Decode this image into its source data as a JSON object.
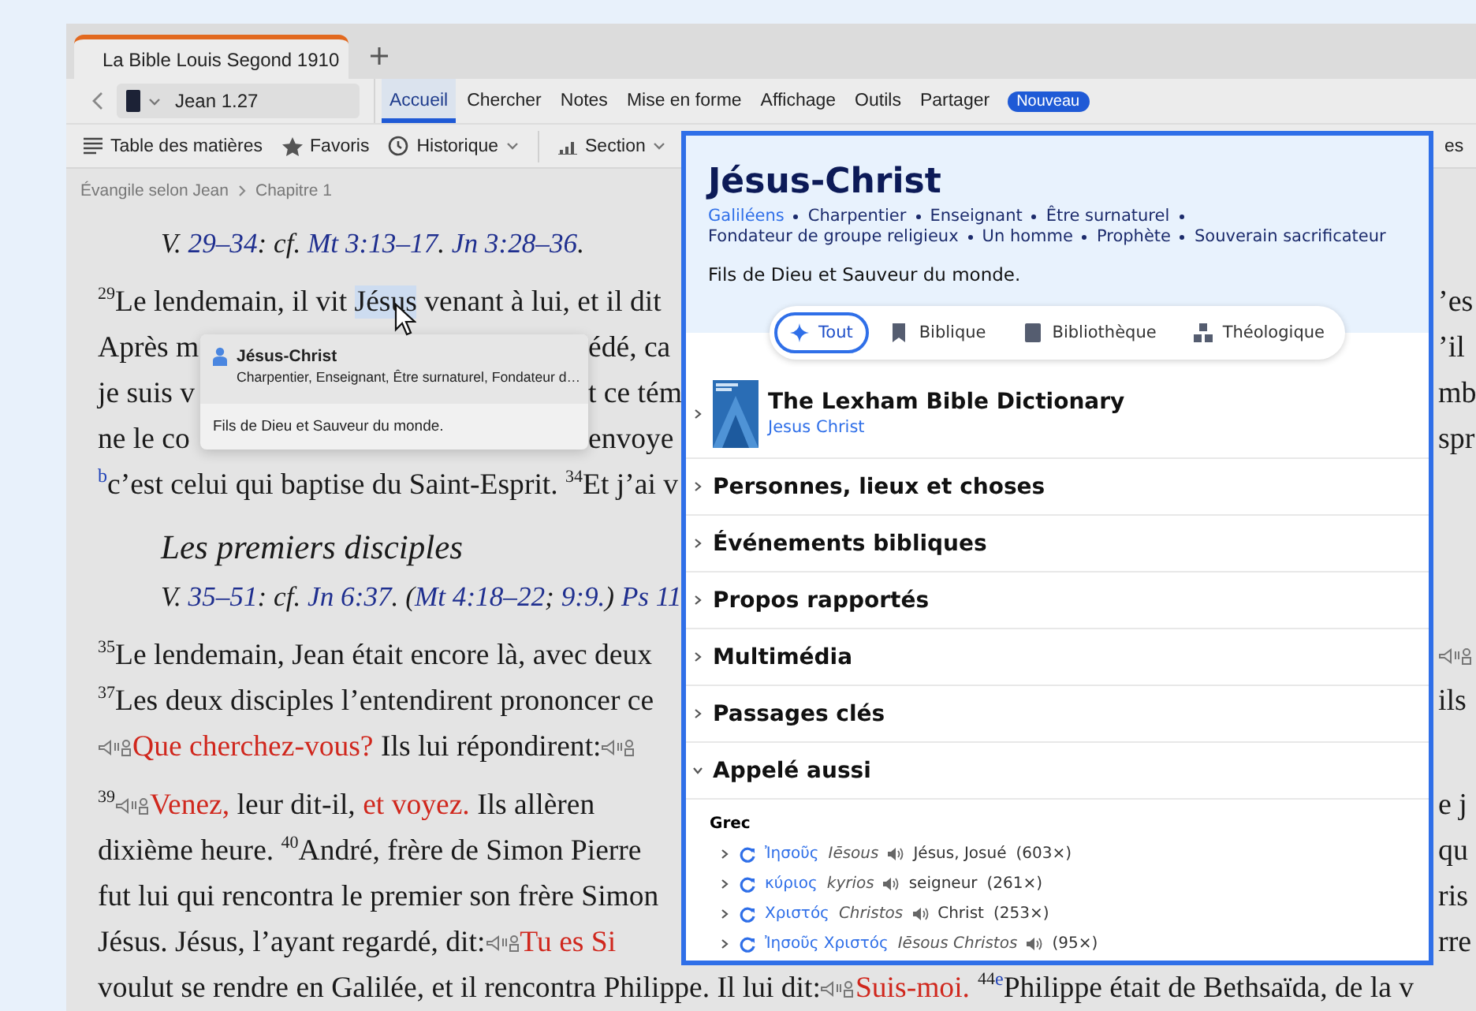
{
  "tabs": [
    {
      "title": "La Bible Louis Segond 1910",
      "selected": true
    }
  ],
  "nav": {
    "reference": "Jean 1.27"
  },
  "menu": [
    {
      "label": "Accueil",
      "selected": true
    },
    {
      "label": "Chercher",
      "selected": false
    },
    {
      "label": "Notes",
      "selected": false
    },
    {
      "label": "Mise en forme",
      "selected": false
    },
    {
      "label": "Affichage",
      "selected": false
    },
    {
      "label": "Outils",
      "selected": false
    },
    {
      "label": "Partager",
      "selected": false
    }
  ],
  "menu_badge": "Nouveau",
  "toolbar": [
    {
      "label": "Table des matières",
      "kind": "toc",
      "dropdown": false
    },
    {
      "label": "Favoris",
      "kind": "star",
      "dropdown": false
    },
    {
      "label": "Historique",
      "kind": "history",
      "dropdown": true
    },
    {
      "label": "Section",
      "kind": "section",
      "dropdown": true
    }
  ],
  "toolbar_fragment": "es",
  "breadcrumb": [
    "Évangile selon Jean",
    "Chapitre 1"
  ],
  "reader": {
    "paragraphs": [
      {
        "kind": "ref",
        "lines": [
          {
            "segments": [
              {
                "kind": "text",
                "text": "V. "
              },
              {
                "kind": "ref",
                "text": "29–34"
              },
              {
                "kind": "text",
                "text": ": cf. "
              },
              {
                "kind": "ref",
                "text": "Mt 3:13–17"
              },
              {
                "kind": "text",
                "text": ". "
              },
              {
                "kind": "ref",
                "text": "Jn 3:28–36"
              },
              {
                "kind": "text",
                "text": "."
              }
            ]
          }
        ]
      },
      {
        "kind": "text",
        "lines": [
          {
            "segments": [
              {
                "kind": "verse",
                "text": "29"
              },
              {
                "kind": "text",
                "text": "Le lendemain, il vit "
              },
              {
                "kind": "highlight",
                "text": "Jésus"
              },
              {
                "kind": "text",
                "text": " venant à lui, et il dit"
              }
            ],
            "edge": "’es"
          },
          {
            "segments": [
              {
                "kind": "text",
                "text": "Après m"
              }
            ],
            "resume": [
              {
                "kind": "text",
                "text": "édé, ca"
              }
            ],
            "edge": "’il"
          },
          {
            "segments": [
              {
                "kind": "text",
                "text": "je suis v"
              }
            ],
            "resume": [
              {
                "kind": "text",
                "text": "t ce tém"
              }
            ],
            "edge": "mb"
          },
          {
            "segments": [
              {
                "kind": "text",
                "text": "ne le co"
              }
            ],
            "resume": [
              {
                "kind": "text",
                "text": "envoye"
              }
            ],
            "edge": "spr"
          },
          {
            "segments": [
              {
                "kind": "note",
                "text": "b"
              },
              {
                "kind": "text",
                "text": "c’est celui qui baptise du Saint-Esprit. "
              },
              {
                "kind": "verse",
                "text": "34"
              },
              {
                "kind": "text",
                "text": "Et j’ai v"
              }
            ]
          }
        ]
      },
      {
        "kind": "heading",
        "lines": [
          {
            "segments": [
              {
                "kind": "text",
                "text": "Les premiers disciples"
              }
            ]
          }
        ]
      },
      {
        "kind": "ref",
        "lines": [
          {
            "segments": [
              {
                "kind": "text",
                "text": "V. "
              },
              {
                "kind": "ref",
                "text": "35–51"
              },
              {
                "kind": "text",
                "text": ": cf. "
              },
              {
                "kind": "ref",
                "text": "Jn 6:37"
              },
              {
                "kind": "text",
                "text": ". ("
              },
              {
                "kind": "ref",
                "text": "Mt 4:18–22"
              },
              {
                "kind": "text",
                "text": "; "
              },
              {
                "kind": "ref",
                "text": "9:9."
              },
              {
                "kind": "text",
                "text": ") "
              },
              {
                "kind": "ref",
                "text": "Ps 11"
              }
            ]
          }
        ]
      },
      {
        "kind": "text",
        "lines": [
          {
            "segments": [
              {
                "kind": "verse",
                "text": "35"
              },
              {
                "kind": "text",
                "text": "Le lendemain, Jean était encore là, avec deux"
              }
            ],
            "edge_marker": true
          },
          {
            "segments": [
              {
                "kind": "verse",
                "text": "37"
              },
              {
                "kind": "text",
                "text": "Les deux disciples l’entendirent prononcer ce"
              }
            ],
            "edge": "ils"
          },
          {
            "segments": [
              {
                "kind": "marker"
              },
              {
                "kind": "speech",
                "text": "Que cherchez-vous?"
              },
              {
                "kind": "text",
                "text": " Ils lui répondirent: "
              },
              {
                "kind": "marker"
              }
            ]
          }
        ]
      },
      {
        "kind": "text",
        "lines": [
          {
            "segments": [
              {
                "kind": "verse",
                "text": "39"
              },
              {
                "kind": "marker"
              },
              {
                "kind": "speech",
                "text": "Venez,"
              },
              {
                "kind": "text",
                "text": " leur dit-il, "
              },
              {
                "kind": "speech",
                "text": "et voyez."
              },
              {
                "kind": "text",
                "text": " Ils allèren"
              }
            ],
            "edge": "e j"
          },
          {
            "segments": [
              {
                "kind": "text",
                "text": "dixième heure. "
              },
              {
                "kind": "verse",
                "text": "40"
              },
              {
                "kind": "text",
                "text": "André, frère de Simon Pierre"
              }
            ],
            "edge": "qu"
          },
          {
            "segments": [
              {
                "kind": "text",
                "text": "fut lui qui rencontra le premier son frère Simon"
              }
            ],
            "edge": "ris"
          },
          {
            "segments": [
              {
                "kind": "text",
                "text": "Jésus. Jésus, l’ayant regardé, dit: "
              },
              {
                "kind": "marker"
              },
              {
                "kind": "speech",
                "text": "Tu es Si"
              }
            ],
            "edge": "rre"
          },
          {
            "segments": [
              {
                "kind": "text",
                "text": "voulut se rendre en Galilée, et il rencontra Philippe. Il lui dit: "
              },
              {
                "kind": "marker"
              },
              {
                "kind": "speech",
                "text": "Suis-moi."
              },
              {
                "kind": "verse",
                "text": "44"
              },
              {
                "kind": "note",
                "text": "e"
              },
              {
                "kind": "text",
                "text": "Philippe était de Bethsaïda, de la v"
              }
            ]
          }
        ]
      }
    ]
  },
  "hover_card": {
    "title": "Jésus-Christ",
    "subtitle": "Charpentier, Enseignant, Être surnaturel, Fondateur d…",
    "description": "Fils de Dieu et Sauveur du monde."
  },
  "panel": {
    "title": "Jésus-Christ",
    "tags": [
      {
        "label": "Galiléens",
        "link": true
      },
      {
        "label": "Charpentier",
        "link": false
      },
      {
        "label": "Enseignant",
        "link": false
      },
      {
        "label": "Être surnaturel",
        "link": false
      },
      {
        "label": "Fondateur de groupe religieux",
        "link": false
      },
      {
        "label": "Un homme",
        "link": false
      },
      {
        "label": "Prophète",
        "link": false
      },
      {
        "label": "Souverain sacrificateur",
        "link": false
      }
    ],
    "description": "Fils de Dieu et Sauveur du monde.",
    "filters": [
      {
        "label": "Tout",
        "kind": "all",
        "selected": true
      },
      {
        "label": "Biblique",
        "kind": "bible",
        "selected": false
      },
      {
        "label": "Bibliothèque",
        "kind": "library",
        "selected": false
      },
      {
        "label": "Théologique",
        "kind": "theology",
        "selected": false
      }
    ],
    "resource": {
      "title": "The Lexham Bible Dictionary",
      "subtitle": "Jesus Christ"
    },
    "sections": [
      {
        "title": "Personnes, lieux et choses",
        "expanded": false
      },
      {
        "title": "Événements bibliques",
        "expanded": false
      },
      {
        "title": "Propos rapportés",
        "expanded": false
      },
      {
        "title": "Multimédia",
        "expanded": false
      },
      {
        "title": "Passages clés",
        "expanded": false
      },
      {
        "title": "Appelé aussi",
        "expanded": true
      }
    ],
    "also_called": {
      "group": "Grec",
      "words": [
        {
          "lemma": "Ἰησοῦς",
          "translit": "Iēsous",
          "gloss": "Jésus, Josué",
          "count": "(603×)"
        },
        {
          "lemma": "κύριος",
          "translit": "kyrios",
          "gloss": "seigneur",
          "count": "(261×)"
        },
        {
          "lemma": "Χριστός",
          "translit": "Christos",
          "gloss": "Christ",
          "count": "(253×)"
        },
        {
          "lemma": "Ἰησοῦς Χριστός",
          "translit": "Iēsous Christos",
          "count": "(95×)"
        }
      ]
    }
  }
}
